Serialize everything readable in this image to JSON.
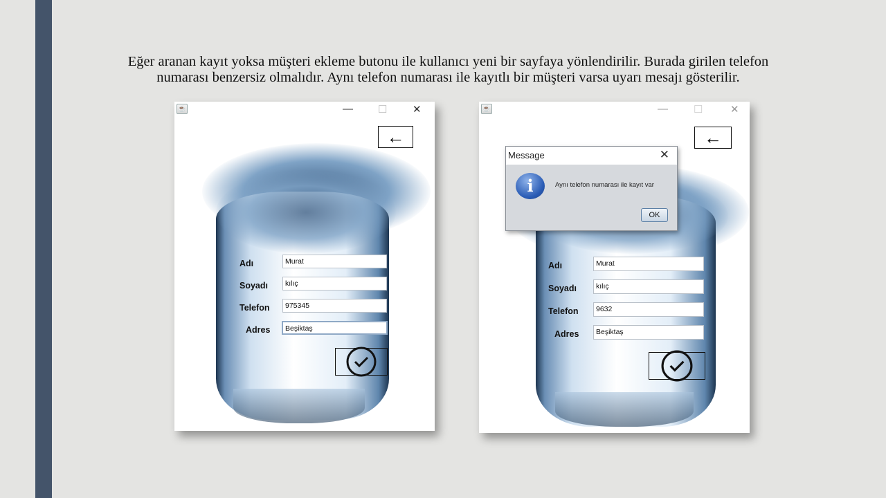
{
  "caption": {
    "line1": "Eğer aranan kayıt yoksa müşteri ekleme butonu ile kullanıcı yeni bir sayfaya yönlendirilir. Burada girilen telefon",
    "line2": "numarası benzersiz olmalıdır. Aynı telefon numarası ile kayıtlı bir müşteri varsa uyarı mesajı gösterilir."
  },
  "labels": {
    "name": "Adı",
    "surname": "Soyadı",
    "phone": "Telefon",
    "address": "Adres"
  },
  "left_form": {
    "name": "Murat",
    "surname": "kılıç",
    "phone": "975345",
    "address": "Beşiktaş"
  },
  "right_form": {
    "name": "Murat",
    "surname": "kılıç",
    "phone": "9632",
    "address": "Beşiktaş"
  },
  "dialog": {
    "title": "Message",
    "message": "Aynı telefon numarası ile kayıt var",
    "ok_label": "OK"
  },
  "colors": {
    "sidebar": "#44546a",
    "background": "#e4e4e2"
  }
}
